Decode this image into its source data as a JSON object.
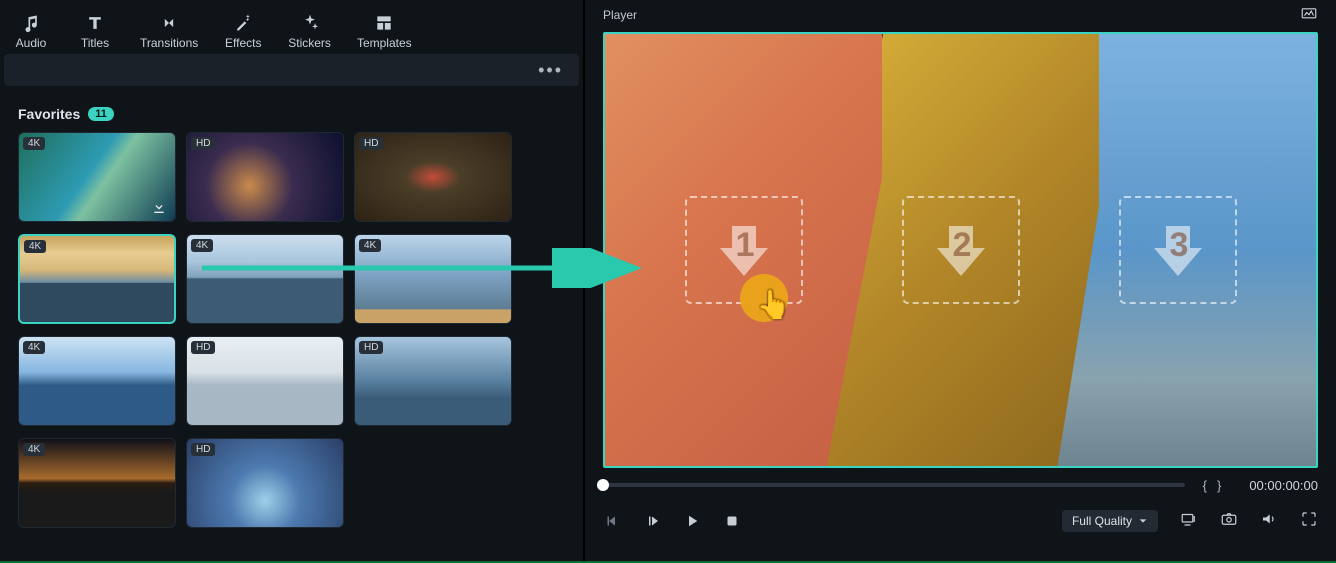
{
  "tabs": {
    "audio": "Audio",
    "titles": "Titles",
    "transitions": "Transitions",
    "effects": "Effects",
    "stickers": "Stickers",
    "templates": "Templates"
  },
  "library": {
    "section_title": "Favorites",
    "count": "11",
    "items": [
      {
        "quality": "4K",
        "has_download": true,
        "selected": false
      },
      {
        "quality": "HD",
        "has_download": false,
        "selected": false
      },
      {
        "quality": "HD",
        "has_download": false,
        "selected": false
      },
      {
        "quality": "4K",
        "has_download": false,
        "selected": true
      },
      {
        "quality": "4K",
        "has_download": false,
        "selected": false
      },
      {
        "quality": "4K",
        "has_download": false,
        "selected": false
      },
      {
        "quality": "4K",
        "has_download": false,
        "selected": false
      },
      {
        "quality": "HD",
        "has_download": false,
        "selected": false
      },
      {
        "quality": "HD",
        "has_download": false,
        "selected": false
      },
      {
        "quality": "4K",
        "has_download": false,
        "selected": false
      },
      {
        "quality": "HD",
        "has_download": false,
        "selected": false
      }
    ]
  },
  "player": {
    "title": "Player",
    "drop_slots": [
      "1",
      "2",
      "3"
    ],
    "timecode": "00:00:00:00",
    "brace_open": "{",
    "brace_close": "}",
    "quality_label": "Full Quality"
  }
}
